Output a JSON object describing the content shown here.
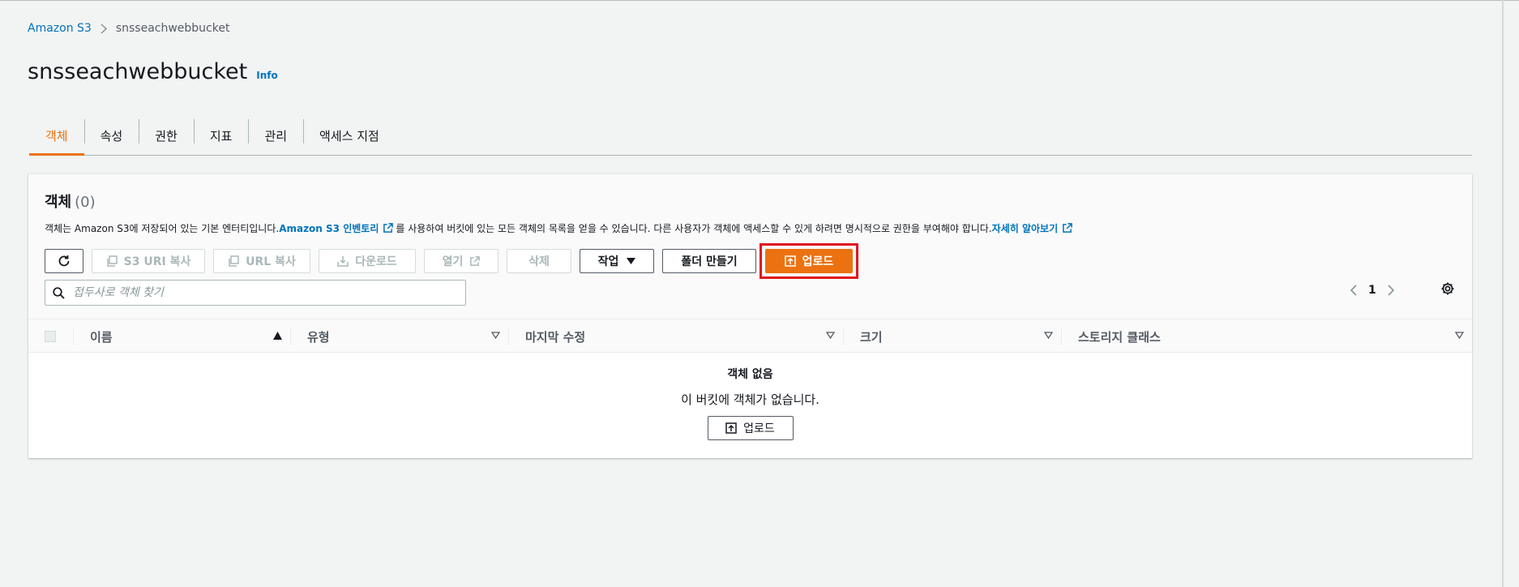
{
  "breadcrumb": {
    "root": "Amazon S3",
    "current": "snsseachwebbucket"
  },
  "header": {
    "title": "snsseachwebbucket",
    "info": "Info"
  },
  "tabs": [
    {
      "label": "객체",
      "active": true
    },
    {
      "label": "속성"
    },
    {
      "label": "권한"
    },
    {
      "label": "지표"
    },
    {
      "label": "관리"
    },
    {
      "label": "액세스 지점"
    }
  ],
  "objects": {
    "title": "객체",
    "count": "(0)",
    "desc_part1": "객체는 Amazon S3에 저장되어 있는 기본 엔터티입니다. ",
    "desc_link1": "Amazon S3 인벤토리",
    "desc_part2": "를 사용하여 버킷에 있는 모든 객체의 목록을 얻을 수 있습니다. 다른 사용자가 객체에 액세스할 수 있게 하려면 명시적으로 권한을 부여해야 합니다. ",
    "desc_link2": "자세히 알아보기"
  },
  "toolbar": {
    "copy_s3_uri": "S3 URI 복사",
    "copy_url": "URL 복사",
    "download": "다운로드",
    "open": "열기",
    "delete": "삭제",
    "actions": "작업",
    "create_folder": "폴더 만들기",
    "upload": "업로드"
  },
  "search": {
    "placeholder": "접두사로 객체 찾기"
  },
  "pagination": {
    "page": "1"
  },
  "table": {
    "columns": [
      "이름",
      "유형",
      "마지막 수정",
      "크기",
      "스토리지 클래스"
    ]
  },
  "empty": {
    "title": "객체 없음",
    "desc": "이 버킷에 객체가 없습니다.",
    "upload": "업로드"
  },
  "colors": {
    "accent": "#ec7211",
    "link": "#0073bb",
    "highlight": "#e0141e"
  }
}
